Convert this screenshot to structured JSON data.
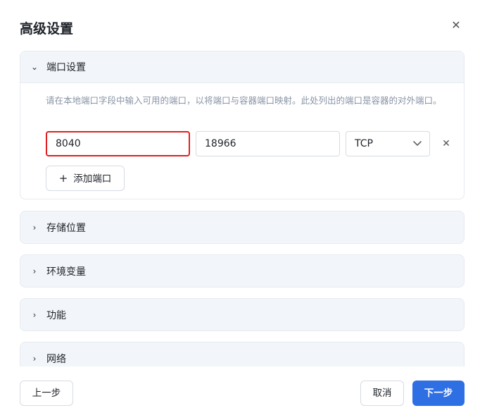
{
  "dialog": {
    "title": "高级设置",
    "close_icon": "close-icon"
  },
  "sections": {
    "ports": {
      "label": "端口设置",
      "expanded": true,
      "hint": "请在本地端口字段中输入可用的端口，以将端口与容器端口映射。此处列出的端口是容器的对外端口。",
      "rows": [
        {
          "local_port": "8040",
          "container_port": "18966",
          "protocol": "TCP"
        }
      ],
      "add_label": "添加端口"
    },
    "storage": {
      "label": "存储位置"
    },
    "env": {
      "label": "环境变量"
    },
    "features": {
      "label": "功能"
    },
    "network": {
      "label": "网络"
    }
  },
  "footer": {
    "prev_label": "上一步",
    "cancel_label": "取消",
    "next_label": "下一步"
  },
  "colors": {
    "primary": "#2f6fe4",
    "highlight_border": "#e02020",
    "section_bg": "#f2f5f9",
    "hint_text": "#8a95a6"
  }
}
